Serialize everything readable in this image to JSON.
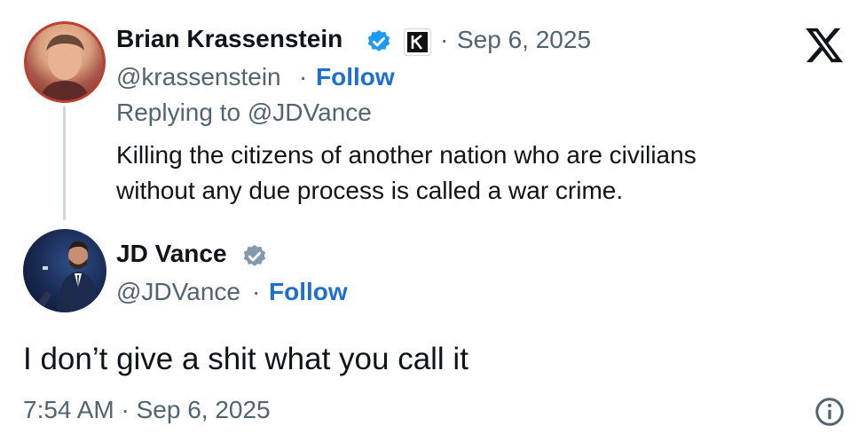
{
  "parent_tweet": {
    "author_name": "Brian Krassenstein",
    "date": "Sep 6, 2025",
    "handle": "@krassenstein",
    "follow_label": "Follow",
    "replying_to_prefix": "Replying to ",
    "replying_to_handle": "@JDVance",
    "text_line1": "Killing the citizens of another nation who are civilians",
    "text_line2": "without any due process is called a war crime."
  },
  "reply_tweet": {
    "author_name": "JD Vance",
    "handle": "@JDVance",
    "follow_label": "Follow",
    "text": "I don’t give a shit what you call it",
    "timestamp": "7:54 AM · Sep 6, 2025"
  },
  "separator": "·",
  "colors": {
    "verified_blue": "#1d9bf0",
    "verified_gray": "#829aab",
    "link_blue": "#1d6fd1",
    "muted": "#536471"
  },
  "icons": {
    "brand": "x-logo-icon",
    "info": "info-icon",
    "affiliation_badge": "k-badge-icon"
  }
}
